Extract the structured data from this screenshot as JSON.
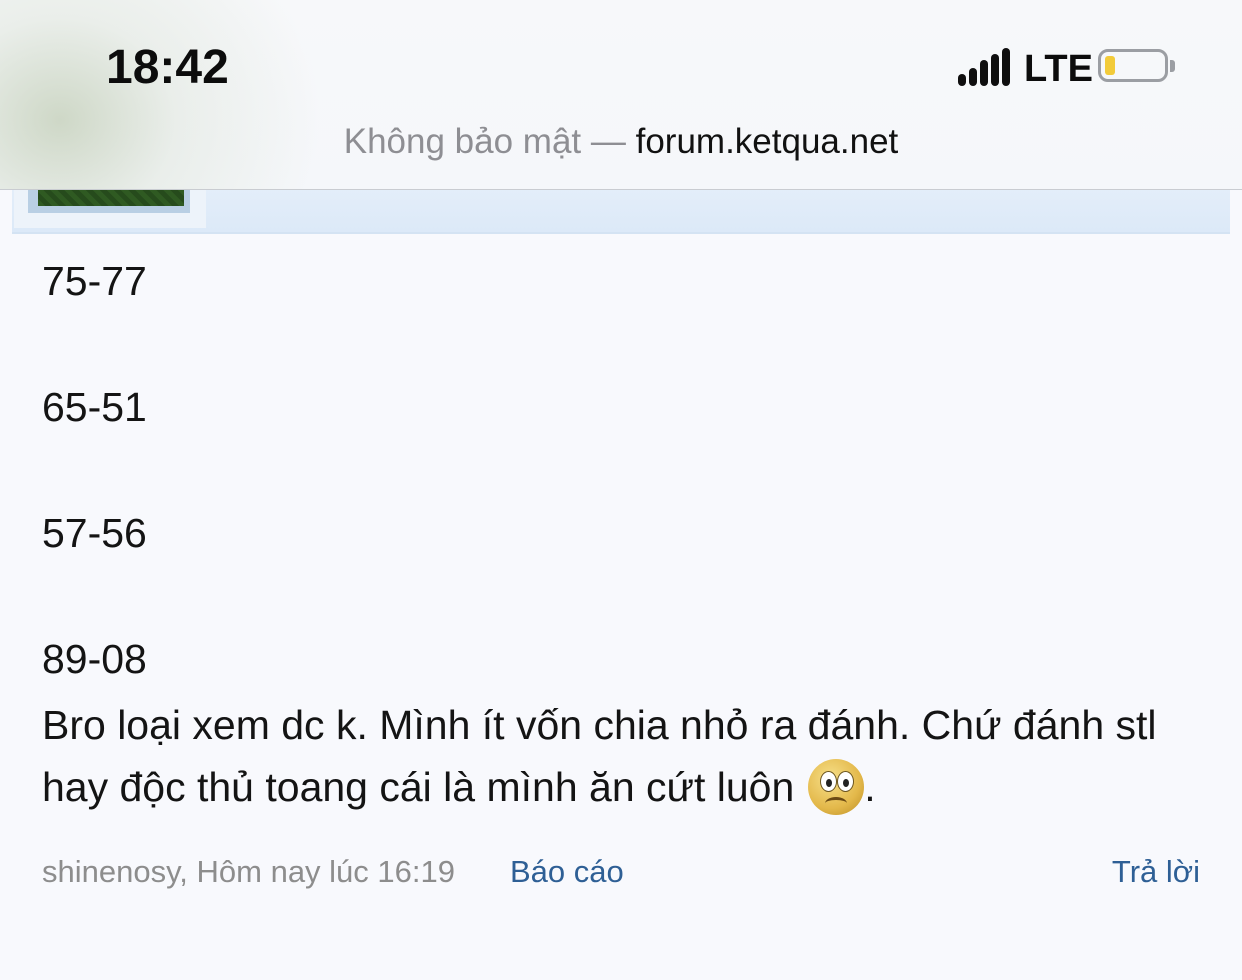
{
  "status_bar": {
    "time": "18:42",
    "network": "LTE",
    "battery_level": 0.1,
    "battery_color": "#f2cb3a",
    "signal_icon": "signal-bars-icon",
    "battery_icon": "battery-low-icon"
  },
  "address_bar": {
    "security_text": "Không bảo mật",
    "separator": "—",
    "domain": "forum.ketqua.net"
  },
  "post": {
    "number_lines": [
      "75-77",
      "65-51",
      "57-56",
      "89-08"
    ],
    "message_part1": "Bro loại xem dc k. Mình ít vốn chia nhỏ ra đánh. Chứ đánh stl hay độc thủ toang cái là mình ăn cứt luôn",
    "emoji_icon": "worried-face-icon",
    "message_end": ".",
    "author_time": "shinenosy, Hôm nay lúc 16:19",
    "report_label": "Báo cáo",
    "reply_label": "Trả lời"
  },
  "colors": {
    "link": "#2e5f95",
    "meta_text": "#8d8d8d",
    "header_strip": "#dce9f8",
    "background": "#f8f9fd"
  }
}
